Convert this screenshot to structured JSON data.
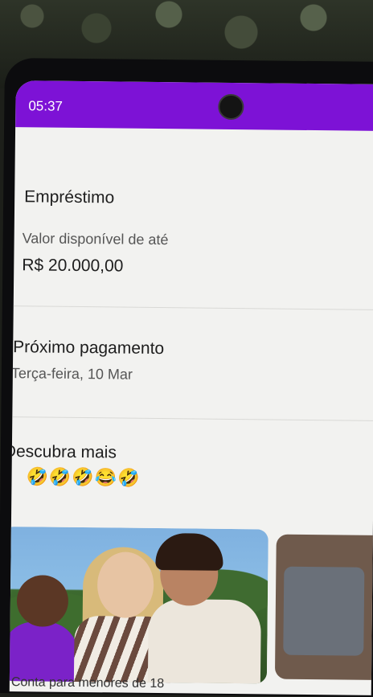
{
  "statusbar": {
    "time": "05:37"
  },
  "loan": {
    "title": "Empréstimo",
    "available_label": "Valor disponível de até",
    "amount": "R$ 20.000,00"
  },
  "next_payment": {
    "title": "Próximo pagamento",
    "date": "Terça-feira, 10 Mar"
  },
  "discover": {
    "title": "Descubra mais",
    "emojis": "🤣🤣🤣😂🤣",
    "cards": [
      {
        "caption": "Conta para menores de 18"
      }
    ]
  },
  "colors": {
    "brand": "#7d12d6",
    "background": "#f2f2f0"
  }
}
